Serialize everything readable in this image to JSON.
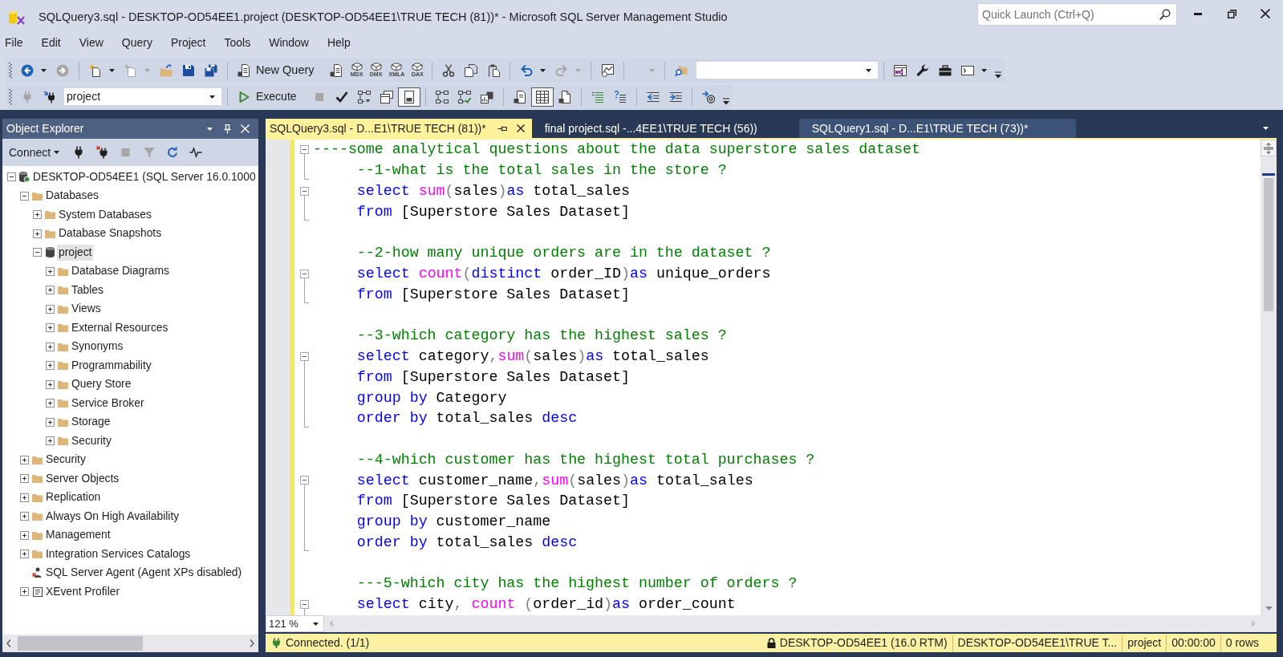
{
  "window": {
    "title": "SQLQuery3.sql - DESKTOP-OD54EE1.project (DESKTOP-OD54EE1\\TRUE TECH (81))* - Microsoft SQL Server Management Studio"
  },
  "quick_launch": {
    "placeholder": "Quick Launch (Ctrl+Q)"
  },
  "menu": [
    "File",
    "Edit",
    "View",
    "Query",
    "Project",
    "Tools",
    "Window",
    "Help"
  ],
  "toolbar_1": [
    {
      "disabled": false
    },
    {
      "disabled": true
    },
    {
      "disabled": false
    },
    {
      "disabled": true
    },
    {
      "disabled": false
    },
    {
      "disabled": false
    },
    {
      "disabled": false
    },
    {
      "label": "New Query",
      "disabled": false
    },
    {
      "disabled": false
    },
    {
      "label": "MDX",
      "disabled": false
    },
    {
      "label": "DMX",
      "disabled": false
    },
    {
      "label": "XMLA",
      "disabled": false
    },
    {
      "label": "DAX",
      "disabled": false
    },
    {
      "disabled": false
    },
    {
      "disabled": false
    },
    {
      "disabled": false
    },
    {
      "disabled": false
    },
    {
      "disabled": true
    },
    {
      "disabled": false
    },
    {
      "disabled": true
    },
    {
      "disabled": false
    },
    {
      "disabled": false
    },
    {
      "disabled": false
    },
    {
      "disabled": false
    },
    {
      "disabled": false
    }
  ],
  "database_selector": {
    "value": "project"
  },
  "toolbar_2": [
    {
      "disabled": true,
      "pressed": false
    },
    {
      "disabled": false,
      "pressed": false
    },
    {
      "label": "Execute",
      "disabled": false,
      "pressed": false
    },
    {
      "disabled": true,
      "pressed": false
    },
    {
      "disabled": false,
      "pressed": false
    },
    {
      "disabled": false,
      "pressed": false
    },
    {
      "disabled": false,
      "pressed": false
    },
    {
      "disabled": false,
      "pressed": true
    },
    {
      "disabled": false,
      "pressed": false
    },
    {
      "disabled": false,
      "pressed": false
    },
    {
      "disabled": false,
      "pressed": false
    },
    {
      "disabled": false,
      "pressed": false
    },
    {
      "disabled": false,
      "pressed": true
    },
    {
      "disabled": false,
      "pressed": false
    },
    {
      "disabled": false,
      "pressed": false
    },
    {
      "disabled": false,
      "pressed": false
    },
    {
      "disabled": false,
      "pressed": false
    },
    {
      "disabled": false,
      "pressed": false
    },
    {
      "disabled": false,
      "pressed": false
    }
  ],
  "object_explorer": {
    "title": "Object Explorer",
    "toolbar": [
      {
        "label": "Connect",
        "disabled": false
      },
      {
        "disabled": false
      },
      {
        "disabled": false
      },
      {
        "disabled": true
      },
      {
        "disabled": true
      },
      {
        "disabled": false
      },
      {
        "disabled": false
      }
    ],
    "tree": [
      {
        "label": "DESKTOP-OD54EE1 (SQL Server 16.0.1000",
        "kind": "server",
        "expanded": true,
        "selected": false,
        "children": [
          {
            "label": "Databases",
            "kind": "folder",
            "expanded": true,
            "selected": false,
            "children": [
              {
                "label": "System Databases",
                "kind": "folder",
                "expanded": false,
                "selected": false
              },
              {
                "label": "Database Snapshots",
                "kind": "folder",
                "expanded": false,
                "selected": false
              },
              {
                "label": "project",
                "kind": "database",
                "expanded": true,
                "selected": true,
                "children": [
                  {
                    "label": "Database Diagrams",
                    "kind": "folder",
                    "expanded": false,
                    "selected": false
                  },
                  {
                    "label": "Tables",
                    "kind": "folder",
                    "expanded": false,
                    "selected": false
                  },
                  {
                    "label": "Views",
                    "kind": "folder",
                    "expanded": false,
                    "selected": false
                  },
                  {
                    "label": "External Resources",
                    "kind": "folder",
                    "expanded": false,
                    "selected": false
                  },
                  {
                    "label": "Synonyms",
                    "kind": "folder",
                    "expanded": false,
                    "selected": false
                  },
                  {
                    "label": "Programmability",
                    "kind": "folder",
                    "expanded": false,
                    "selected": false
                  },
                  {
                    "label": "Query Store",
                    "kind": "folder",
                    "expanded": false,
                    "selected": false
                  },
                  {
                    "label": "Service Broker",
                    "kind": "folder",
                    "expanded": false,
                    "selected": false
                  },
                  {
                    "label": "Storage",
                    "kind": "folder",
                    "expanded": false,
                    "selected": false
                  },
                  {
                    "label": "Security",
                    "kind": "folder",
                    "expanded": false,
                    "selected": false
                  }
                ]
              }
            ]
          },
          {
            "label": "Security",
            "kind": "folder",
            "expanded": false,
            "selected": false
          },
          {
            "label": "Server Objects",
            "kind": "folder",
            "expanded": false,
            "selected": false
          },
          {
            "label": "Replication",
            "kind": "folder",
            "expanded": false,
            "selected": false
          },
          {
            "label": "Always On High Availability",
            "kind": "folder",
            "expanded": false,
            "selected": false
          },
          {
            "label": "Management",
            "kind": "folder",
            "expanded": false,
            "selected": false
          },
          {
            "label": "Integration Services Catalogs",
            "kind": "folder",
            "expanded": false,
            "selected": false
          },
          {
            "label": "SQL Server Agent (Agent XPs disabled)",
            "kind": "agent",
            "selected": false
          },
          {
            "label": "XEvent Profiler",
            "kind": "profiler",
            "expanded": false,
            "selected": false
          }
        ]
      }
    ]
  },
  "editor": {
    "tabs": [
      {
        "label": "SQLQuery3.sql - D...E1\\TRUE TECH (81))*",
        "selected": true,
        "highlighted": false
      },
      {
        "label": "final project.sql -...4EE1\\TRUE TECH (56))",
        "selected": false,
        "highlighted": false
      },
      {
        "label": "SQLQuery1.sql - D...E1\\TRUE TECH (73))*",
        "selected": false,
        "highlighted": true
      }
    ],
    "lines": [
      {
        "kind": "code",
        "expanded": true,
        "tokens": [
          {
            "kind": "comment",
            "text": "----some analytical questions about the data superstore sales dataset"
          }
        ],
        "children": [
          {
            "kind": "code",
            "tokens": [
              {
                "kind": "comment",
                "text": "     --1-what is the total sales in the store ?"
              }
            ]
          }
        ]
      },
      {
        "kind": "code",
        "expanded": true,
        "tokens": [
          {
            "kind": "keyword",
            "text": "     select "
          },
          {
            "kind": "function",
            "text": "sum"
          },
          {
            "kind": "operator",
            "text": "("
          },
          {
            "kind": "plain",
            "text": "sales"
          },
          {
            "kind": "operator",
            "text": ")"
          },
          {
            "kind": "keyword",
            "text": "as"
          },
          {
            "kind": "plain",
            "text": " total_sales"
          }
        ],
        "children": [
          {
            "kind": "code",
            "tokens": [
              {
                "kind": "keyword",
                "text": "     from"
              },
              {
                "kind": "plain",
                "text": " [Superstore Sales Dataset]"
              }
            ]
          }
        ]
      },
      {
        "kind": "blank"
      },
      {
        "kind": "code",
        "tokens": [
          {
            "kind": "comment",
            "text": "     --2-how many unique orders are in the dataset ?"
          }
        ]
      },
      {
        "kind": "code",
        "expanded": true,
        "tokens": [
          {
            "kind": "keyword",
            "text": "     select "
          },
          {
            "kind": "function",
            "text": "count"
          },
          {
            "kind": "operator",
            "text": "("
          },
          {
            "kind": "keyword",
            "text": "distinct"
          },
          {
            "kind": "plain",
            "text": " order_ID"
          },
          {
            "kind": "operator",
            "text": ")"
          },
          {
            "kind": "keyword",
            "text": "as"
          },
          {
            "kind": "plain",
            "text": " unique_orders"
          }
        ],
        "children": [
          {
            "kind": "code",
            "tokens": [
              {
                "kind": "keyword",
                "text": "     from"
              },
              {
                "kind": "plain",
                "text": " [Superstore Sales Dataset]"
              }
            ]
          }
        ]
      },
      {
        "kind": "blank"
      },
      {
        "kind": "code",
        "tokens": [
          {
            "kind": "comment",
            "text": "     --3-which category has the highest sales ?"
          }
        ]
      },
      {
        "kind": "code",
        "expanded": true,
        "tokens": [
          {
            "kind": "keyword",
            "text": "     select"
          },
          {
            "kind": "plain",
            "text": " category"
          },
          {
            "kind": "operator",
            "text": ","
          },
          {
            "kind": "function",
            "text": "sum"
          },
          {
            "kind": "operator",
            "text": "("
          },
          {
            "kind": "plain",
            "text": "sales"
          },
          {
            "kind": "operator",
            "text": ")"
          },
          {
            "kind": "keyword",
            "text": "as"
          },
          {
            "kind": "plain",
            "text": " total_sales"
          }
        ],
        "children": [
          {
            "kind": "code",
            "tokens": [
              {
                "kind": "keyword",
                "text": "     from"
              },
              {
                "kind": "plain",
                "text": " [Superstore Sales Dataset]"
              }
            ]
          },
          {
            "kind": "code",
            "tokens": [
              {
                "kind": "keyword",
                "text": "     group by"
              },
              {
                "kind": "plain",
                "text": " Category"
              }
            ]
          },
          {
            "kind": "code",
            "tokens": [
              {
                "kind": "keyword",
                "text": "     order by"
              },
              {
                "kind": "plain",
                "text": " total_sales "
              },
              {
                "kind": "keyword",
                "text": "desc"
              }
            ]
          }
        ]
      },
      {
        "kind": "blank"
      },
      {
        "kind": "code",
        "tokens": [
          {
            "kind": "comment",
            "text": "     --4-which customer has the highest total purchases ?"
          }
        ]
      },
      {
        "kind": "code",
        "expanded": true,
        "tokens": [
          {
            "kind": "keyword",
            "text": "     select"
          },
          {
            "kind": "plain",
            "text": " customer_name"
          },
          {
            "kind": "operator",
            "text": ","
          },
          {
            "kind": "function",
            "text": "sum"
          },
          {
            "kind": "operator",
            "text": "("
          },
          {
            "kind": "plain",
            "text": "sales"
          },
          {
            "kind": "operator",
            "text": ")"
          },
          {
            "kind": "keyword",
            "text": "as"
          },
          {
            "kind": "plain",
            "text": " total_sales"
          }
        ],
        "children": [
          {
            "kind": "code",
            "tokens": [
              {
                "kind": "keyword",
                "text": "     from"
              },
              {
                "kind": "plain",
                "text": " [Superstore Sales Dataset]"
              }
            ]
          },
          {
            "kind": "code",
            "tokens": [
              {
                "kind": "keyword",
                "text": "     group by"
              },
              {
                "kind": "plain",
                "text": " customer_name"
              }
            ]
          },
          {
            "kind": "code",
            "tokens": [
              {
                "kind": "keyword",
                "text": "     order by"
              },
              {
                "kind": "plain",
                "text": " total_sales "
              },
              {
                "kind": "keyword",
                "text": "desc"
              }
            ]
          }
        ]
      },
      {
        "kind": "blank"
      },
      {
        "kind": "code",
        "tokens": [
          {
            "kind": "comment",
            "text": "     ---5-which city has the highest number of orders ?"
          }
        ]
      },
      {
        "kind": "code",
        "expanded": true,
        "tokens": [
          {
            "kind": "keyword",
            "text": "     select"
          },
          {
            "kind": "plain",
            "text": " city"
          },
          {
            "kind": "operator",
            "text": ","
          },
          {
            "kind": "function",
            "text": " count"
          },
          {
            "kind": "operator",
            "text": " ("
          },
          {
            "kind": "plain",
            "text": "order_id"
          },
          {
            "kind": "operator",
            "text": ")"
          },
          {
            "kind": "keyword",
            "text": "as"
          },
          {
            "kind": "plain",
            "text": " order_count"
          }
        ]
      }
    ],
    "zoom": "121 %"
  },
  "status_bar": {
    "connection": "Connected. (1/1)",
    "server": "DESKTOP-OD54EE1 (16.0 RTM)",
    "login": "DESKTOP-OD54EE1\\TRUE T...",
    "database": "project",
    "elapsed": "00:00:00",
    "rows": "0 rows"
  }
}
